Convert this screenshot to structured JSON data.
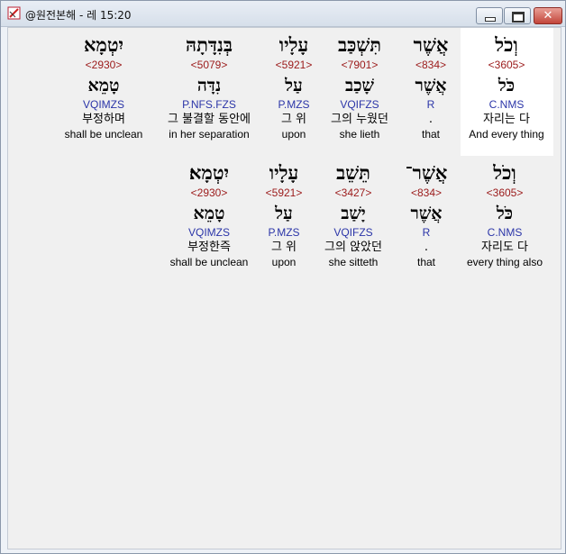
{
  "window": {
    "title": "@원전본해 - 레 15:20",
    "icons": {
      "app": "bible-app-icon",
      "minimize": "minimize-icon",
      "maximize": "maximize-icon",
      "close": "close-icon"
    },
    "close_glyph": "✕"
  },
  "colors": {
    "strong": "#9b1a1a",
    "parse": "#2b35a8",
    "highlight": "#ffffff"
  },
  "rows": [
    {
      "words": [
        {
          "hebrew": "וְכֹל",
          "strong": "<3605>",
          "lemma": "כֹּל",
          "parse": "C.NMS",
          "korean": "자리는 다",
          "english": "And every thing"
        },
        {
          "hebrew": "אֲשֶׁר",
          "strong": "<834>",
          "lemma": "אֲשֶׁר",
          "parse": "R",
          "korean": ".",
          "english": "that"
        },
        {
          "hebrew": "תִּשְׁכַּב",
          "strong": "<7901>",
          "lemma": "שָׁכַב",
          "parse": "VQIFZS",
          "korean": "그의 누웠던",
          "english": "she lieth"
        },
        {
          "hebrew": "עָלָיו",
          "strong": "<5921>",
          "lemma": "עַל",
          "parse": "P.MZS",
          "korean": "그 위",
          "english": "upon"
        },
        {
          "hebrew": "בְּנִדָּתָהּ",
          "strong": "<5079>",
          "lemma": "נִדָּה",
          "parse": "P.NFS.FZS",
          "korean": "그 불결할 동안에",
          "english": "in her separation"
        },
        {
          "hebrew": "יִטְמָא",
          "strong": "<2930>",
          "lemma": "טָמֵא",
          "parse": "VQIMZS",
          "korean": "부정하며",
          "english": "shall be unclean"
        }
      ]
    },
    {
      "words": [
        {
          "hebrew": "וְכֹל",
          "strong": "<3605>",
          "lemma": "כֹּל",
          "parse": "C.NMS",
          "korean": "자리도 다",
          "english": "every thing also"
        },
        {
          "hebrew": "אֲשֶׁר־",
          "strong": "<834>",
          "lemma": "אֲשֶׁר",
          "parse": "R",
          "korean": ".",
          "english": "that"
        },
        {
          "hebrew": "תֵּשֵׁב",
          "strong": "<3427>",
          "lemma": "יָשַׁב",
          "parse": "VQIFZS",
          "korean": "그의 앉았던",
          "english": "she sitteth"
        },
        {
          "hebrew": "עָלָיו",
          "strong": "<5921>",
          "lemma": "עַל",
          "parse": "P.MZS",
          "korean": "그 위",
          "english": "upon"
        },
        {
          "hebrew": "יִטְמָא׃",
          "strong": "<2930>",
          "lemma": "טָמֵא",
          "parse": "VQIMZS",
          "korean": "부정한즉",
          "english": "shall be unclean"
        }
      ]
    }
  ]
}
